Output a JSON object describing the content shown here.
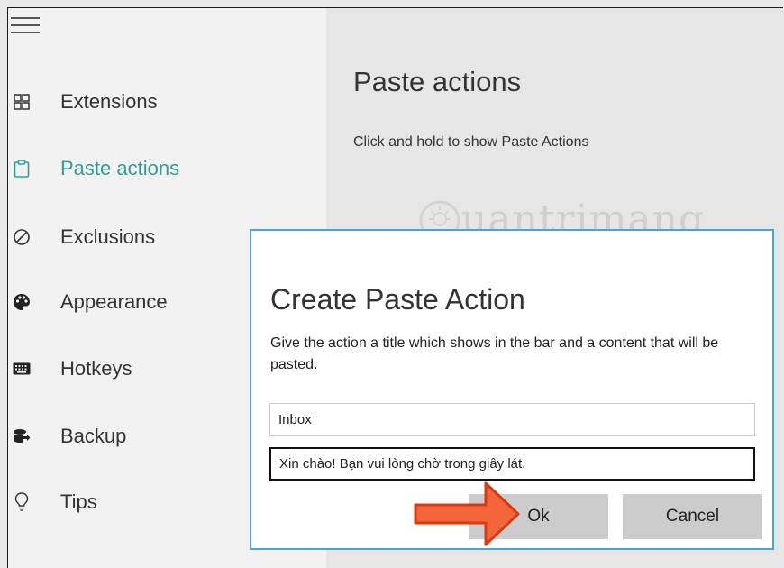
{
  "sidebar": {
    "items": [
      {
        "label": "Extensions",
        "icon": "extensions-icon"
      },
      {
        "label": "Paste actions",
        "icon": "clipboard-icon",
        "active": true
      },
      {
        "label": "Exclusions",
        "icon": "prohibited-icon"
      },
      {
        "label": "Appearance",
        "icon": "palette-icon"
      },
      {
        "label": "Hotkeys",
        "icon": "keyboard-icon"
      },
      {
        "label": "Backup",
        "icon": "backup-icon"
      },
      {
        "label": "Tips",
        "icon": "lightbulb-icon"
      }
    ]
  },
  "main": {
    "title": "Paste actions",
    "description": "Click and hold to show Paste Actions"
  },
  "watermark": "uantrimang",
  "dialog": {
    "title": "Create Paste Action",
    "description": "Give the action a title which shows in the bar and a content that will be pasted.",
    "title_value": "Inbox",
    "content_value": "Xin chào! Bạn vui lòng chờ trong giây lát.",
    "ok_label": "Ok",
    "cancel_label": "Cancel"
  },
  "colors": {
    "accent": "#2f9e93",
    "dialog_border": "#44a6dd",
    "arrow_fill": "#f4653a"
  }
}
